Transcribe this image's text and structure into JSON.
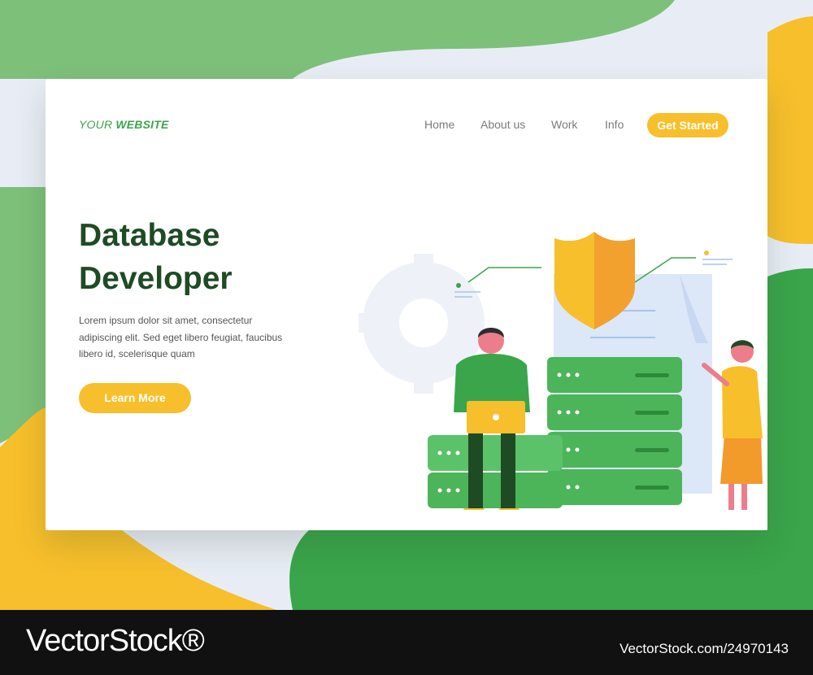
{
  "site": {
    "logo_prefix": "YOUR ",
    "logo_strong": "WEBSITE"
  },
  "nav": {
    "items": [
      "Home",
      "About us",
      "Work",
      "Info"
    ],
    "cta": "Get Started"
  },
  "hero": {
    "title_line1": "Database",
    "title_line2": "Developer",
    "body_lines": [
      "Lorem ipsum dolor sit amet, consectetur",
      "adipiscing elit. Sed eget libero feugiat, faucibus",
      "libero id, scelerisque quam"
    ],
    "button": "Learn More"
  },
  "colors": {
    "green": "#3aa54a",
    "yellow": "#f7bf2b",
    "dark_green": "#1e4b24",
    "light_green": "#7dc07a"
  },
  "watermark": {
    "brand": "VectorStock®",
    "id": "VectorStock.com/24970143"
  },
  "icons": [
    "shield-icon",
    "gear-icon",
    "server-stack-icon",
    "coin-stack-icon",
    "laptop-icon",
    "document-icon"
  ]
}
